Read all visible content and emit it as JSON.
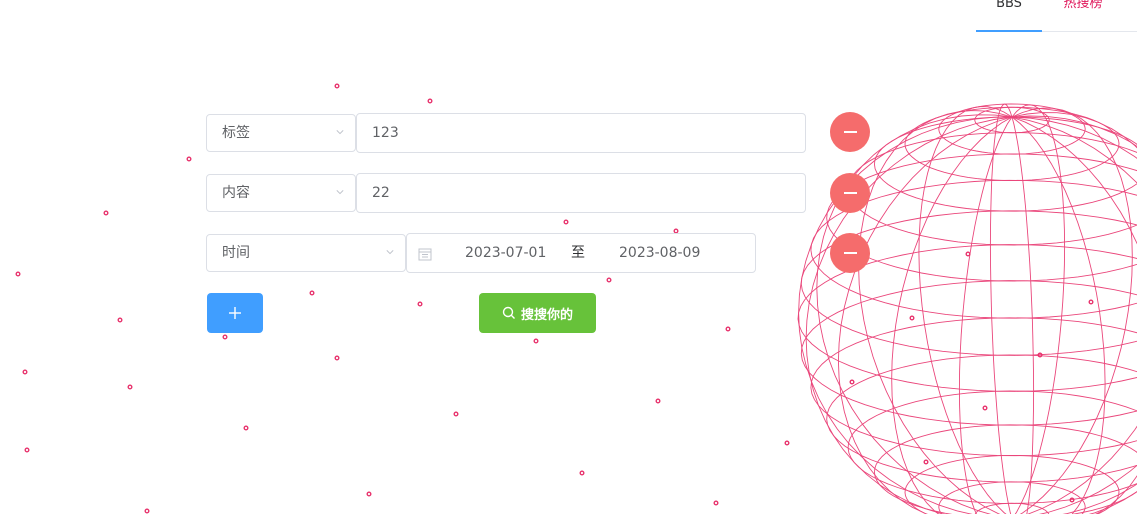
{
  "tabs": [
    {
      "label": "BBS",
      "active": true
    },
    {
      "label": "热搜榜",
      "active": false
    }
  ],
  "filters": [
    {
      "field": "标签",
      "value": "123"
    },
    {
      "field": "内容",
      "value": "22"
    },
    {
      "field": "时间",
      "start_date": "2023-07-01",
      "range_separator": "至",
      "end_date": "2023-08-09"
    }
  ],
  "icons": {
    "remove": "minus-icon",
    "add": "plus-icon",
    "search": "search-icon",
    "calendar": "calendar-icon",
    "dropdown": "chevron-down-icon"
  },
  "actions": {
    "search_label": "搜搜你的"
  },
  "colors": {
    "primary": "#409eff",
    "success": "#67c23a",
    "danger": "#f56c6c",
    "decoration": "#e8336d"
  }
}
